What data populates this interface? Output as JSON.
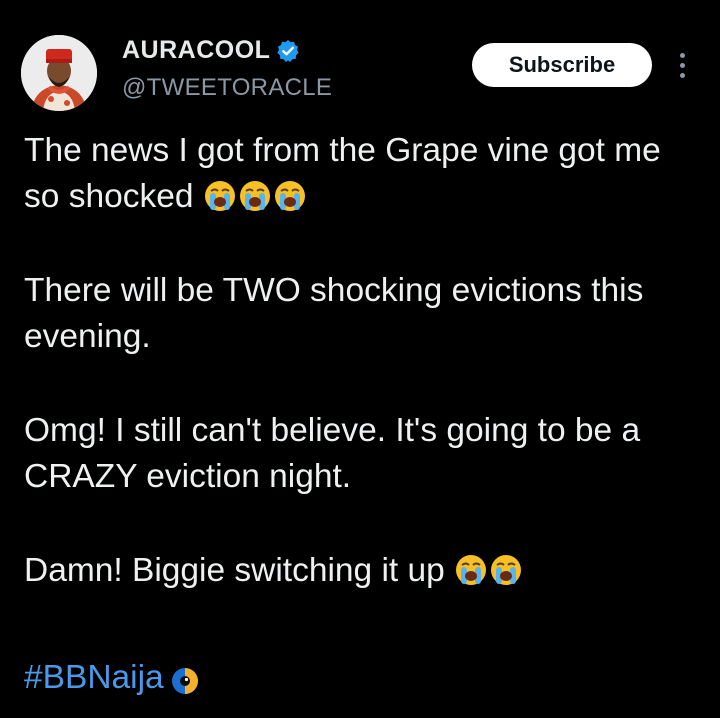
{
  "author": {
    "name": "AURACOOL",
    "handle": "@TWEETORACLE",
    "verified": true
  },
  "actions": {
    "subscribe_label": "Subscribe"
  },
  "tweet": {
    "para1_text": "The news I got from the Grape vine got me so shocked",
    "para1_emojis": [
      "loudly-crying-face",
      "loudly-crying-face",
      "loudly-crying-face"
    ],
    "para2_text": "There will be TWO shocking evictions this evening.",
    "para3_text": "Omg! I still can't believe. It's going to be a CRAZY eviction night.",
    "para4_text": "Damn! Biggie switching it up",
    "para4_emojis": [
      "loudly-crying-face",
      "loudly-crying-face"
    ],
    "hashtag": "#BBNaija",
    "hashtag_icon": "bbnaija-eye-icon"
  },
  "colors": {
    "background": "#000000",
    "text": "#e7e9ea",
    "handle": "#8b98a5",
    "link": "#4a99e9",
    "verified": "#1d9bf0",
    "button_bg": "#ffffff"
  }
}
